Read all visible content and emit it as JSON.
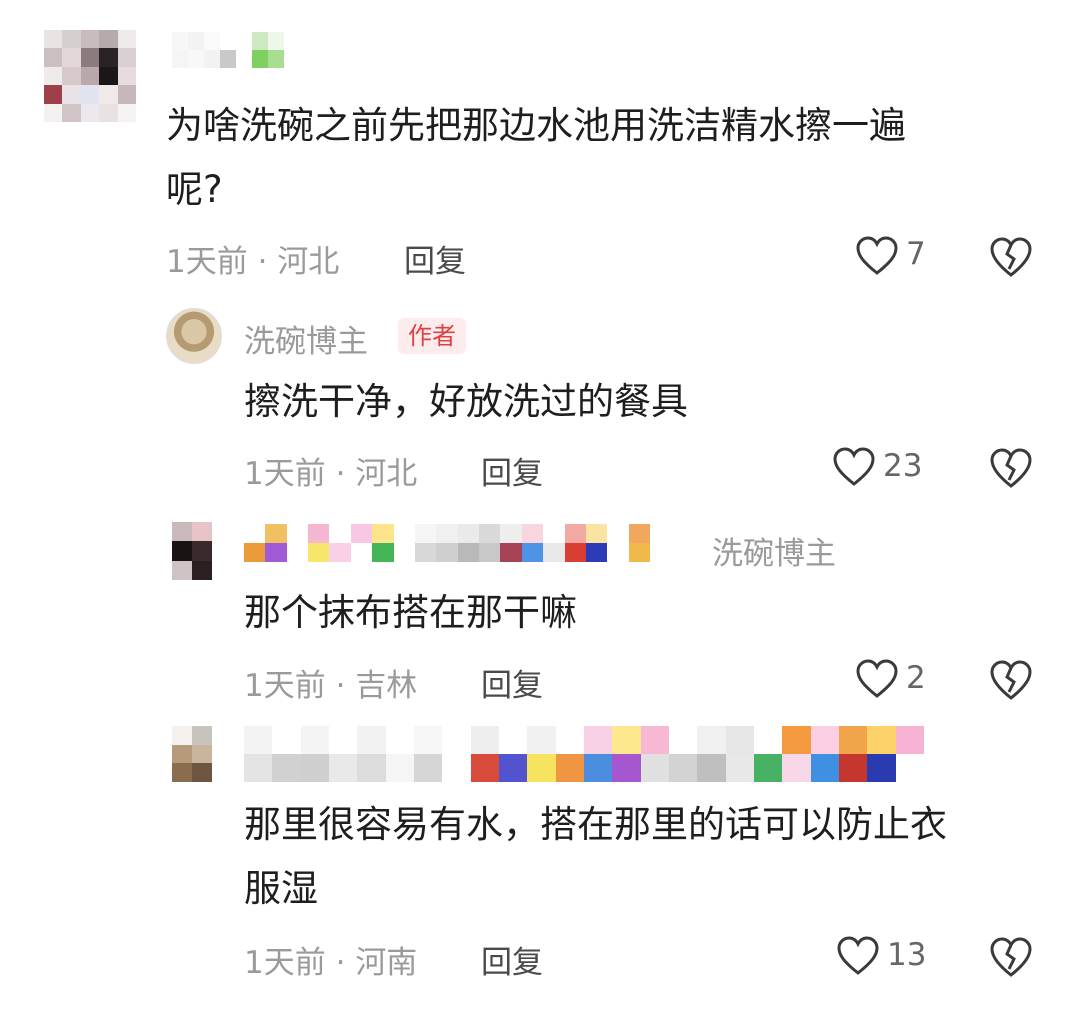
{
  "comments": [
    {
      "text_line1": "为啥洗碗之前先把那边水池用洗洁精水擦一遍",
      "text_line2": "呢?",
      "time": "1天前",
      "location": "河北",
      "reply_label": "回复",
      "likes": "7"
    },
    {
      "username": "洗碗博主",
      "author_tag": "作者",
      "text": "擦洗干净，好放洗过的餐具",
      "time": "1天前",
      "location": "河北",
      "reply_label": "回复",
      "likes": "23"
    },
    {
      "reply_to": "洗碗博主",
      "text": "那个抹布搭在那干嘛",
      "time": "1天前",
      "location": "吉林",
      "reply_label": "回复",
      "likes": "2"
    },
    {
      "text_line1": "那里很容易有水，搭在那里的话可以防止衣",
      "text_line2": "服湿",
      "time": "1天前",
      "location": "河南",
      "reply_label": "回复",
      "likes": "13"
    }
  ],
  "separator": "·",
  "colors": {
    "author_tag": "#e23e45",
    "meta_text": "#9a9a9a",
    "icon_stroke": "#3a3a3a"
  },
  "icons": [
    "heart-icon",
    "dislike-broken-heart-icon"
  ]
}
